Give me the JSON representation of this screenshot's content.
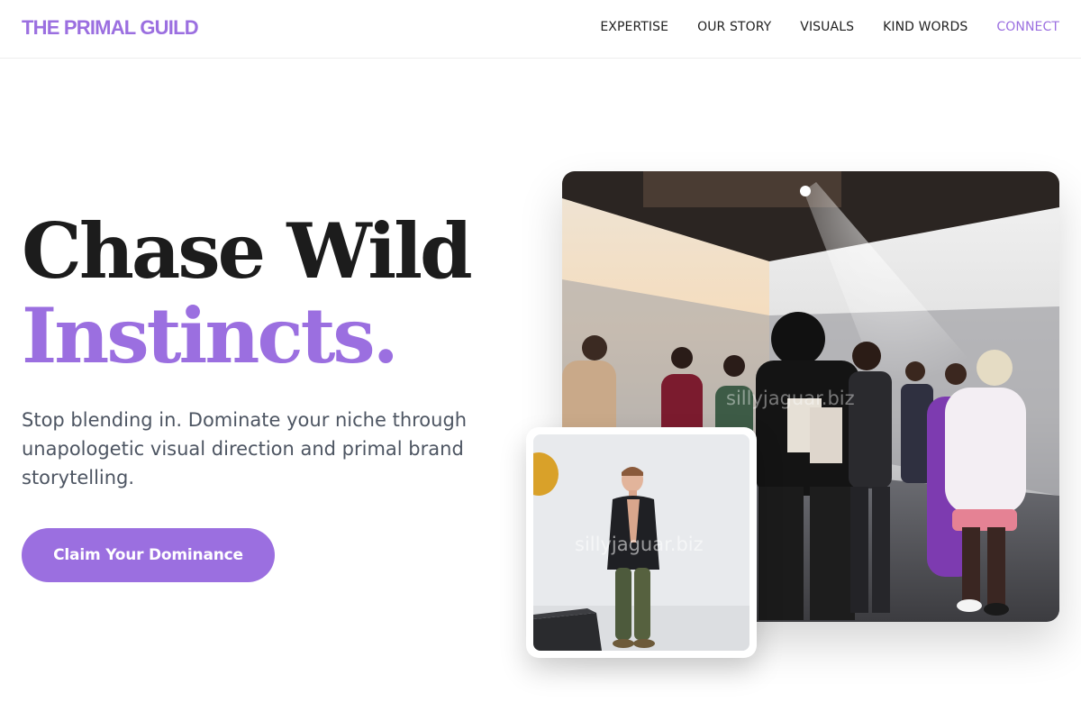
{
  "brand": {
    "name": "THE PRIMAL GUILD",
    "accent": "#9b6fe0"
  },
  "nav": {
    "items": [
      {
        "label": "EXPERTISE"
      },
      {
        "label": "OUR STORY"
      },
      {
        "label": "VISUALS"
      },
      {
        "label": "KIND WORDS"
      },
      {
        "label": "CONNECT",
        "active": true
      }
    ]
  },
  "hero": {
    "headline_line1": "Chase Wild",
    "headline_line2": "Instincts.",
    "subcopy": "Stop blending in. Dominate your niche through unapologetic visual direction and primal brand storytelling.",
    "cta_label": "Claim Your Dominance"
  },
  "images": {
    "main_watermark": "sillyjaguar.biz",
    "inset_watermark": "sillyjaguar.biz"
  }
}
